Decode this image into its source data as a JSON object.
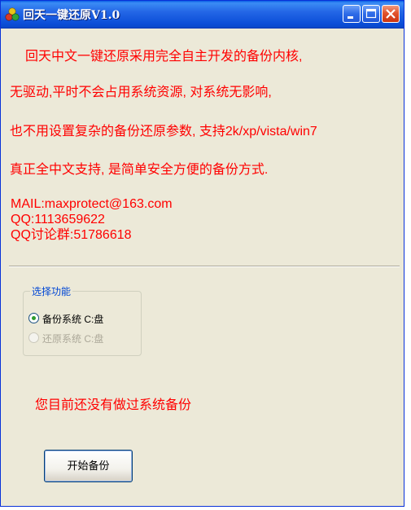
{
  "window": {
    "title": "回天一键还原V1.0"
  },
  "description": {
    "lines": [
      "回天中文一键还原采用完全自主开发的备份内核,",
      "无驱动,平时不会占用系统资源, 对系统无影响,",
      "也不用设置复杂的备份还原参数, 支持2k/xp/vista/win7",
      "真正全中文支持, 是简单安全方便的备份方式."
    ]
  },
  "contact": {
    "mail": "MAIL:maxprotect@163.com",
    "qq": "QQ:1113659622",
    "qq_group": "QQ讨论群:51786618"
  },
  "function_group": {
    "legend": "选择功能",
    "options": [
      {
        "label": "备份系统 C:盘",
        "selected": true,
        "enabled": true
      },
      {
        "label": "还原系统 C:盘",
        "selected": false,
        "enabled": false
      }
    ]
  },
  "status": {
    "message": "您目前还没有做过系统备份"
  },
  "actions": {
    "start_button_label": "开始备份"
  },
  "colors": {
    "text_accent": "#ff0000",
    "titlebar": "#0b4ed8",
    "window_bg": "#ece9d8",
    "legend": "#0046d5"
  }
}
